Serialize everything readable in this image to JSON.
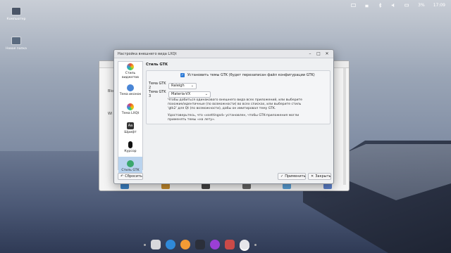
{
  "tray": {
    "battery": "3%",
    "clock": "17:09"
  },
  "desktop": [
    {
      "label": "Компьютер",
      "color": "#4a5567"
    },
    {
      "label": "Новая папка",
      "color": "#5b6b80"
    }
  ],
  "back_window": {
    "fragments": [
      "Blo",
      "Wi"
    ]
  },
  "window": {
    "title": "Настройка внешнего вида LXQt",
    "controls": [
      "–",
      "□",
      "✕"
    ]
  },
  "sidebar": {
    "items": [
      {
        "label": "Стиль виджетов",
        "color": "#f0f0f0",
        "active": false
      },
      {
        "label": "Тема иконок",
        "color": "#4a86d6",
        "active": false
      },
      {
        "label": "Тема LXQt",
        "color": "#e8a13a",
        "active": false
      },
      {
        "label": "Шрифт",
        "color": "#333333",
        "active": false
      },
      {
        "label": "Курсор",
        "color": "#111111",
        "active": false
      },
      {
        "label": "Стиль GTK",
        "color": "#3aa76d",
        "active": true
      }
    ]
  },
  "content": {
    "section_title": "Стиль GTK",
    "checkbox_label": "Установить темы GTK (будет перезаписан файл конфигурации GTK)",
    "checkbox_checked": true,
    "gtk2_label": "Тема GTK 2",
    "gtk2_value": "Raleigh",
    "gtk3_label": "Тема GTK 3",
    "gtk3_value": "Materia-VX",
    "hint1": "Чтобы добиться одинакового внешнего вида всех приложений, или выберите похожие/идентичные (по возможности) во всех списках, или выберите стиль 'gtk2' для Qt (по возможности), дабы он имитировал тему GTK.",
    "hint2": "Удостоверьтесь, что «xsettingsd» установлен, чтобы GTK-приложения могли применять темы «на лету»."
  },
  "buttons": {
    "reset": "Сбросить",
    "apply": "Применить",
    "close": "Закрыть"
  },
  "dock": {
    "items": [
      {
        "name": "files",
        "color": "#d8d8dc"
      },
      {
        "name": "browser",
        "color": "#2f89d9"
      },
      {
        "name": "settings",
        "color": "#f29b35"
      },
      {
        "name": "terminal",
        "color": "#2b2f3a"
      },
      {
        "name": "player",
        "color": "#9b3fd6"
      },
      {
        "name": "monitor",
        "color": "#c94a48"
      },
      {
        "name": "appearance",
        "color": "#e6e6ea"
      }
    ]
  }
}
